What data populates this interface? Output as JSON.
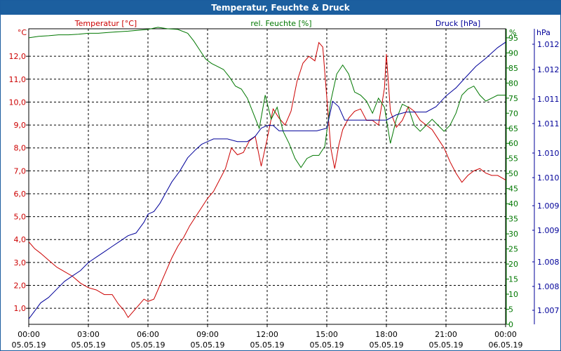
{
  "window": {
    "title": "Temperatur, Feuchte & Druck"
  },
  "colors": {
    "temperature": "#cc0000",
    "humidity": "#007700",
    "pressure": "#000099",
    "titlebar": "#1c5f9f"
  },
  "chart_data": {
    "type": "line",
    "grid": true,
    "x": {
      "tick_labels": [
        [
          "00:00",
          "05.05.19"
        ],
        [
          "03:00",
          "05.05.19"
        ],
        [
          "06:00",
          "05.05.19"
        ],
        [
          "09:00",
          "05.05.19"
        ],
        [
          "12:00",
          "05.05.19"
        ],
        [
          "15:00",
          "05.05.19"
        ],
        [
          "18:00",
          "05.05.19"
        ],
        [
          "21:00",
          "05.05.19"
        ],
        [
          "00:00",
          "06.05.19"
        ]
      ],
      "range_hours": [
        0,
        24
      ]
    },
    "axes": {
      "temperature": {
        "title": "Temperatur [°C]",
        "unit": "°C",
        "range": [
          0.3,
          13.2
        ],
        "ticks": [
          "1,0",
          "2,0",
          "3,0",
          "4,0",
          "5,0",
          "6,0",
          "7,0",
          "8,0",
          "9,0",
          "10,0",
          "11,0",
          "12,0"
        ]
      },
      "humidity": {
        "title": "rel. Feuchte [%]",
        "unit": "%",
        "range": [
          0,
          98
        ],
        "ticks": [
          "0",
          "5",
          "10",
          "15",
          "20",
          "25",
          "30",
          "35",
          "40",
          "45",
          "50",
          "55",
          "60",
          "65",
          "70",
          "75",
          "80",
          "85",
          "90",
          "95"
        ]
      },
      "pressure": {
        "title": "Druck [hPa]",
        "unit": "hPa",
        "range": [
          1006.8,
          1012.3
        ],
        "ticks": [
          "1.007",
          "1.008",
          "1.008",
          "1.009",
          "1.009",
          "1.010",
          "1.010",
          "1.011",
          "1.011",
          "1.012",
          "1.012"
        ]
      }
    },
    "series": [
      {
        "name": "Temperatur [°C]",
        "axis": "temperature",
        "color": "#cc0000",
        "x": [
          0,
          0.3,
          0.6,
          1.0,
          1.4,
          1.8,
          2.2,
          2.6,
          3.0,
          3.4,
          3.8,
          4.2,
          4.5,
          4.8,
          5.0,
          5.2,
          5.5,
          5.8,
          6.0,
          6.3,
          6.6,
          6.9,
          7.2,
          7.5,
          7.8,
          8.1,
          8.4,
          8.7,
          9.0,
          9.3,
          9.6,
          9.9,
          10.2,
          10.5,
          10.8,
          11.1,
          11.4,
          11.7,
          12.0,
          12.3,
          12.6,
          12.9,
          13.2,
          13.5,
          13.8,
          14.1,
          14.4,
          14.6,
          14.8,
          15.0,
          15.2,
          15.4,
          15.6,
          15.8,
          16.1,
          16.4,
          16.7,
          17.0,
          17.3,
          17.6,
          17.9,
          18.0,
          18.2,
          18.5,
          18.8,
          19.1,
          19.4,
          19.7,
          20.0,
          20.3,
          20.6,
          20.9,
          21.2,
          21.5,
          21.8,
          22.1,
          22.4,
          22.7,
          23.0,
          23.3,
          23.6,
          24.0
        ],
        "y": [
          3.9,
          3.6,
          3.4,
          3.1,
          2.8,
          2.6,
          2.4,
          2.1,
          1.9,
          1.8,
          1.6,
          1.6,
          1.2,
          0.9,
          0.6,
          0.8,
          1.1,
          1.4,
          1.3,
          1.4,
          2.0,
          2.6,
          3.2,
          3.7,
          4.1,
          4.6,
          5.0,
          5.4,
          5.8,
          6.1,
          6.6,
          7.1,
          8.0,
          7.7,
          7.8,
          8.3,
          8.5,
          7.2,
          8.4,
          9.7,
          9.3,
          9.0,
          9.6,
          10.9,
          11.7,
          12.0,
          11.8,
          12.6,
          12.4,
          10.2,
          8.0,
          7.1,
          8.1,
          8.8,
          9.3,
          9.6,
          9.7,
          9.2,
          9.2,
          9.0,
          10.6,
          12.1,
          9.6,
          8.9,
          9.2,
          9.8,
          9.6,
          9.2,
          9.0,
          8.8,
          8.4,
          8.0,
          7.4,
          6.9,
          6.5,
          6.8,
          7.0,
          7.1,
          6.9,
          6.8,
          6.8,
          6.6
        ]
      },
      {
        "name": "rel. Feuchte [%]",
        "axis": "humidity",
        "color": "#007700",
        "x": [
          0,
          0.5,
          1.0,
          1.5,
          2.0,
          2.5,
          3.0,
          3.5,
          4.0,
          4.5,
          5.0,
          5.5,
          6.0,
          6.5,
          7.0,
          7.5,
          8.0,
          8.3,
          8.6,
          8.9,
          9.2,
          9.5,
          9.8,
          10.1,
          10.4,
          10.7,
          11.0,
          11.3,
          11.6,
          11.9,
          12.2,
          12.5,
          12.8,
          13.1,
          13.4,
          13.7,
          14.0,
          14.3,
          14.6,
          14.9,
          15.2,
          15.5,
          15.8,
          16.1,
          16.4,
          16.7,
          17.0,
          17.3,
          17.6,
          17.9,
          18.2,
          18.5,
          18.8,
          19.1,
          19.4,
          19.7,
          20.0,
          20.3,
          20.6,
          20.9,
          21.2,
          21.5,
          21.8,
          22.1,
          22.4,
          22.7,
          23.0,
          23.3,
          23.6,
          24.0
        ],
        "y": [
          95,
          95.5,
          95.7,
          96,
          96,
          96.2,
          96.5,
          96.5,
          96.8,
          97,
          97.2,
          97.5,
          97.8,
          98.5,
          98,
          97.8,
          96.5,
          94,
          91,
          88,
          86.5,
          85.5,
          84.5,
          82,
          79,
          78,
          75,
          70,
          65,
          76,
          68,
          72,
          64,
          60,
          55,
          52,
          55,
          56,
          56,
          59,
          74,
          83,
          86,
          83,
          77,
          76,
          74,
          70,
          75,
          72,
          60,
          68,
          73,
          72,
          66,
          64,
          66,
          68,
          66,
          64,
          66,
          70,
          76,
          78,
          79,
          76,
          74,
          75,
          76,
          76
        ]
      },
      {
        "name": "Druck [hPa]",
        "axis": "pressure",
        "color": "#000099",
        "x": [
          0,
          0.3,
          0.6,
          1.0,
          1.4,
          1.8,
          2.2,
          2.6,
          3.0,
          3.4,
          3.8,
          4.2,
          4.6,
          5.0,
          5.4,
          5.8,
          6.0,
          6.3,
          6.6,
          6.9,
          7.2,
          7.6,
          8.0,
          8.4,
          8.7,
          9.0,
          9.3,
          9.6,
          10.0,
          10.5,
          11.0,
          11.4,
          11.7,
          12.0,
          12.3,
          12.6,
          13.0,
          13.5,
          14.0,
          14.5,
          15.0,
          15.3,
          15.6,
          15.9,
          16.2,
          16.6,
          17.0,
          17.5,
          18.0,
          18.5,
          19.0,
          19.5,
          20.0,
          20.5,
          21.0,
          21.5,
          22.0,
          22.5,
          23.0,
          23.3,
          23.6,
          24.0
        ],
        "y": [
          1006.9,
          1007.05,
          1007.2,
          1007.3,
          1007.45,
          1007.6,
          1007.7,
          1007.8,
          1007.95,
          1008.05,
          1008.15,
          1008.25,
          1008.35,
          1008.45,
          1008.5,
          1008.7,
          1008.85,
          1008.9,
          1009.05,
          1009.25,
          1009.45,
          1009.65,
          1009.9,
          1010.05,
          1010.15,
          1010.2,
          1010.25,
          1010.25,
          1010.25,
          1010.2,
          1010.2,
          1010.3,
          1010.45,
          1010.5,
          1010.5,
          1010.4,
          1010.4,
          1010.4,
          1010.4,
          1010.4,
          1010.45,
          1010.95,
          1010.85,
          1010.6,
          1010.6,
          1010.6,
          1010.6,
          1010.6,
          1010.6,
          1010.7,
          1010.75,
          1010.75,
          1010.75,
          1010.85,
          1011.05,
          1011.2,
          1011.4,
          1011.6,
          1011.75,
          1011.85,
          1011.95,
          1012.05
        ]
      }
    ]
  }
}
